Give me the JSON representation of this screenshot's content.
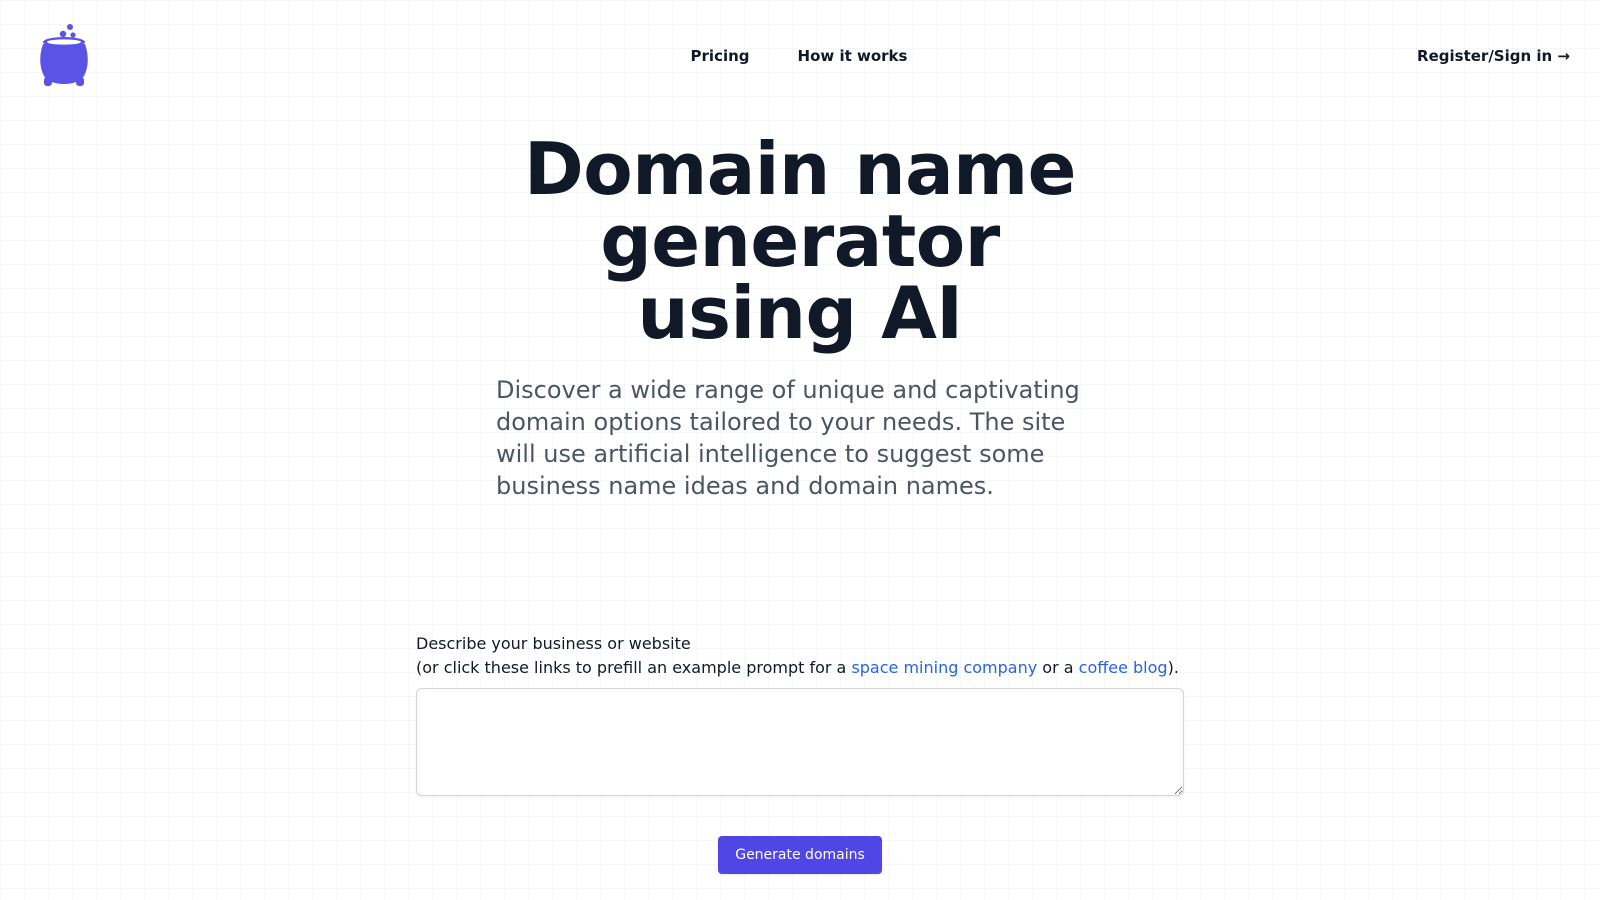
{
  "brand": {
    "logo_icon": "cauldron-icon",
    "accent": "#5b52e6"
  },
  "nav": {
    "items": [
      {
        "label": "Pricing"
      },
      {
        "label": "How it works"
      }
    ],
    "signin_label": "Register/Sign in →"
  },
  "hero": {
    "title_lines": [
      "Domain name",
      "generator",
      "using AI"
    ],
    "subtitle": "Discover a wide range of unique and captivating domain options tailored to your needs. The site will use artificial intelligence to suggest some business name ideas and domain names."
  },
  "form": {
    "label": "Describe your business or website",
    "hint_prefix": "(or click these links to prefill an example prompt for a ",
    "example_1": "space mining company",
    "hint_middle": " or a ",
    "example_2": "coffee blog",
    "hint_suffix": ").",
    "textarea_value": "",
    "button_label": "Generate domains",
    "button_color": "#4f46e5",
    "link_color": "#2563eb"
  }
}
